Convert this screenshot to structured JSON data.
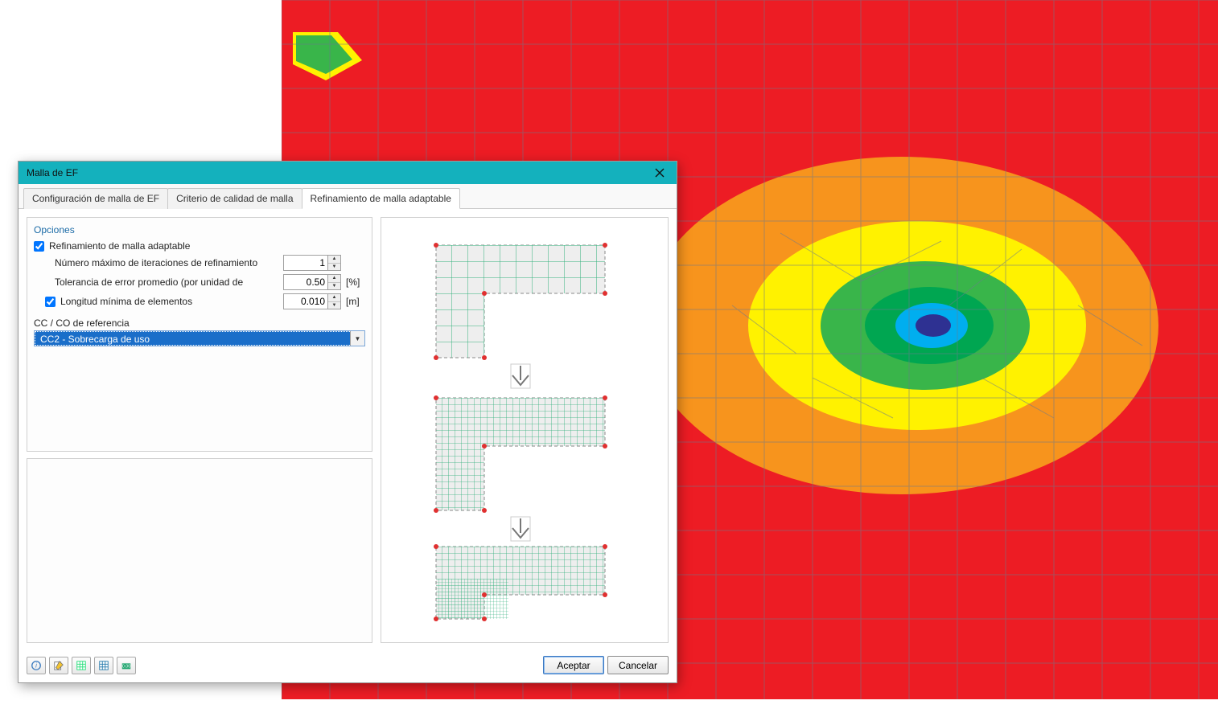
{
  "dialog": {
    "title": "Malla de EF",
    "tabs": [
      "Configuración de malla de EF",
      "Criterio de calidad de malla",
      "Refinamiento de malla adaptable"
    ],
    "active_tab": 2,
    "options_title": "Opciones",
    "adaptive_label": "Refinamiento de malla adaptable",
    "adaptive_checked": true,
    "max_iter_label": "Número máximo de iteraciones de refinamiento",
    "max_iter_value": "1",
    "tolerance_label": "Tolerancia de error promedio (por unidad de",
    "tolerance_value": "0.50",
    "tolerance_unit": "[%]",
    "minlen_label": "Longitud mínima de elementos",
    "minlen_checked": true,
    "minlen_value": "0.010",
    "minlen_unit": "[m]",
    "ref_title": "CC / CO de referencia",
    "ref_value": "CC2 - Sobrecarga de uso",
    "accept": "Aceptar",
    "cancel": "Cancelar"
  },
  "toolbar_icons": [
    "help",
    "edit",
    "opt1",
    "opt2",
    "reset"
  ],
  "colors": {
    "contour": {
      "red": "#ed1c24",
      "orange": "#f7941d",
      "yellow": "#fff200",
      "green1": "#39b54a",
      "green2": "#00a651",
      "cyan": "#00aeef",
      "blue": "#2e3192"
    },
    "mesh_stroke": "#6b7a8d"
  }
}
